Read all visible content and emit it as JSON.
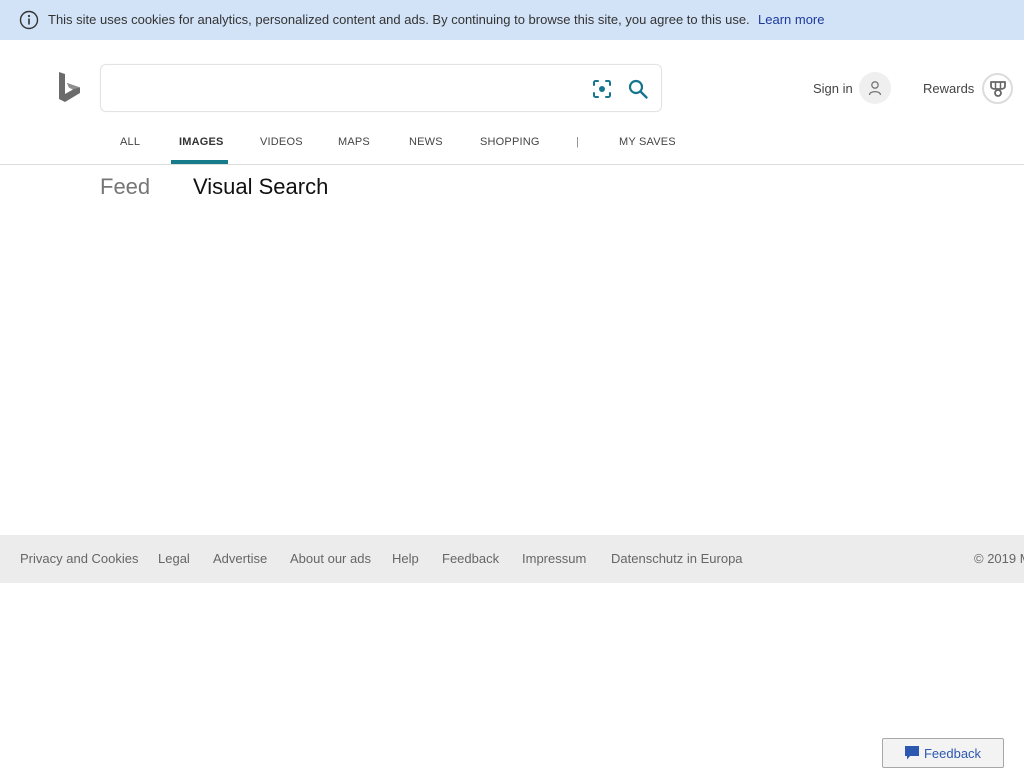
{
  "cookie_banner": {
    "icon": "info-icon",
    "message": "This site uses cookies for analytics, personalized content and ads. By continuing to browse this site, you agree to this use.",
    "learn_more": "Learn more"
  },
  "header": {
    "logo": "bing-logo",
    "search": {
      "value": "",
      "placeholder": "",
      "visual_search_icon": "visual-search-icon",
      "search_icon": "search-icon"
    },
    "sign_in": "Sign in",
    "rewards": "Rewards"
  },
  "nav": {
    "items": [
      {
        "label": "ALL",
        "active": false
      },
      {
        "label": "IMAGES",
        "active": true
      },
      {
        "label": "VIDEOS",
        "active": false
      },
      {
        "label": "MAPS",
        "active": false
      },
      {
        "label": "NEWS",
        "active": false
      },
      {
        "label": "SHOPPING",
        "active": false
      }
    ],
    "separator": "|",
    "my_saves": "MY SAVES",
    "accent_color": "#167c8c"
  },
  "subtabs": {
    "feed": "Feed",
    "visual_search": "Visual Search",
    "active": "Visual Search"
  },
  "footer": {
    "links": [
      "Privacy and Cookies",
      "Legal",
      "Advertise",
      "About our ads",
      "Help",
      "Feedback",
      "Impressum",
      "Datenschutz in Europa"
    ],
    "copyright": "© 2019 M"
  },
  "feedback_button": {
    "label": "Feedback",
    "icon": "feedback-bubble-icon"
  }
}
